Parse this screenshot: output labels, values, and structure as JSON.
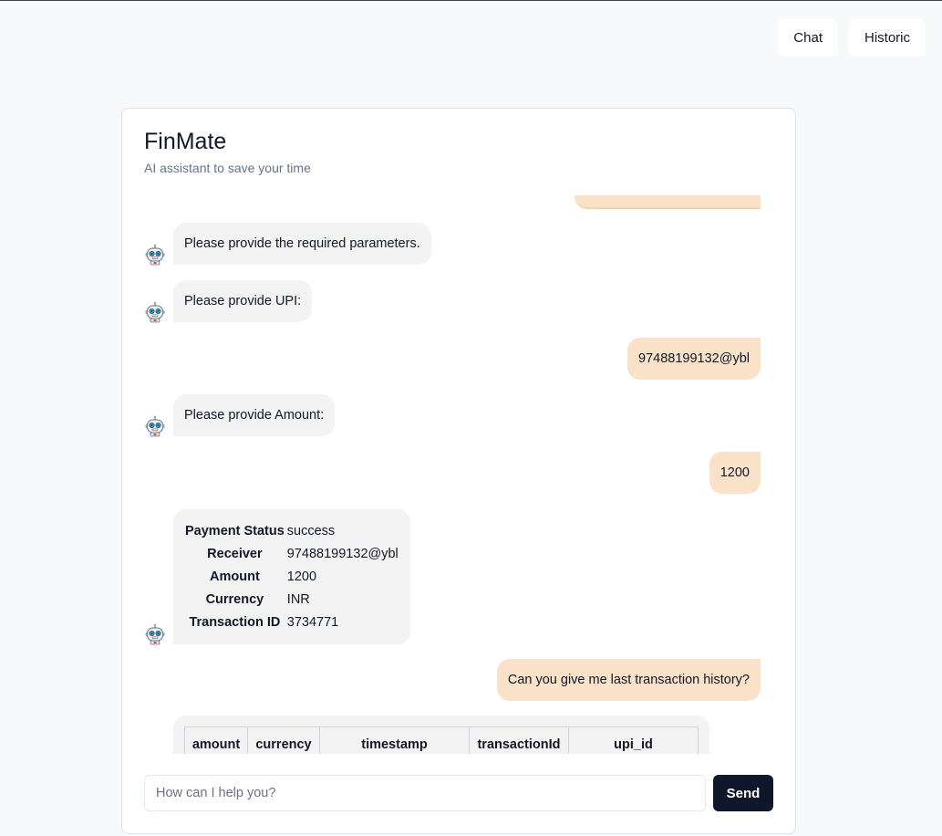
{
  "nav": {
    "chat_label": "Chat",
    "historic_label": "Historic"
  },
  "app": {
    "title": "FinMate",
    "subtitle": "AI assistant to save your time"
  },
  "messages": {
    "m1": "Please provide the required parameters.",
    "m2": "Please provide UPI:",
    "u1": "97488199132@ybl",
    "m3": "Please provide Amount:",
    "u2": "1200",
    "u3": "Can you give me last transaction history?"
  },
  "payment": {
    "status_label": "Payment Status",
    "status_value": "success",
    "receiver_label": "Receiver",
    "receiver_value": "97488199132@ybl",
    "amount_label": "Amount",
    "amount_value": "1200",
    "currency_label": "Currency",
    "currency_value": "INR",
    "txn_label": "Transaction ID",
    "txn_value": "3734771"
  },
  "history_table": {
    "columns": [
      "amount",
      "currency",
      "timestamp",
      "transactionId",
      "upi_id"
    ]
  },
  "input": {
    "placeholder": "How can I help you?",
    "value": ""
  },
  "send_label": "Send",
  "icons": {
    "bot": "robot-icon"
  },
  "colors": {
    "user_bubble": "#f9e2c7",
    "bot_bubble": "#f3f3f3",
    "send_button": "#0f172a"
  }
}
